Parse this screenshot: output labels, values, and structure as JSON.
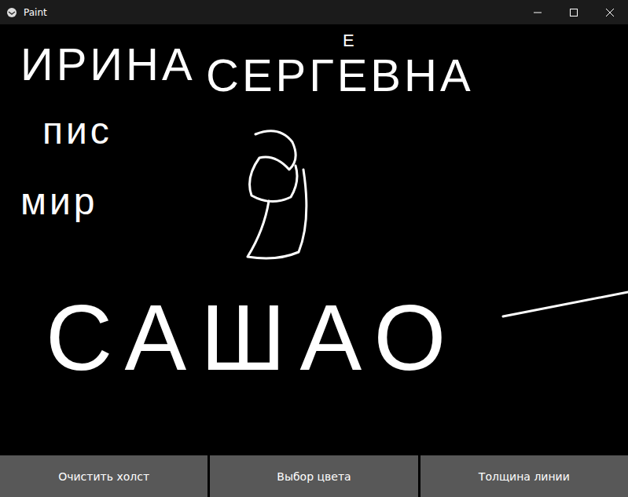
{
  "window": {
    "title": "Paint"
  },
  "canvas": {
    "writings": [
      {
        "text": "ИРИНА",
        "kind": "big"
      },
      {
        "text": "СЕРГЕВНА",
        "kind": "big"
      },
      {
        "text": "Е",
        "kind": "small"
      },
      {
        "text": "пис",
        "kind": "medium"
      },
      {
        "text": "мир",
        "kind": "medium"
      },
      {
        "text": "САШАО",
        "kind": "huge"
      }
    ]
  },
  "buttons": [
    "Очистить холст",
    "Выбор цвета",
    "Толщина линии"
  ]
}
